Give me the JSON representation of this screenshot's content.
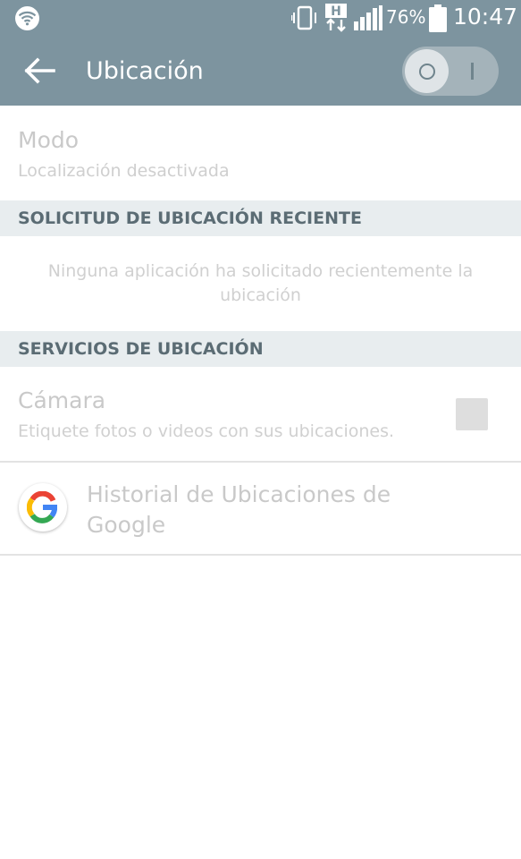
{
  "status_bar": {
    "battery_percent": "76%",
    "time": "10:47",
    "icons": [
      "wifi-icon",
      "vibrate-icon",
      "h-data-icon",
      "signal-icon",
      "battery-icon"
    ]
  },
  "action_bar": {
    "title": "Ubicación",
    "back_icon": "back-arrow-icon",
    "toggle": {
      "state": "off"
    }
  },
  "mode": {
    "title": "Modo",
    "subtitle": "Localización desactivada"
  },
  "recent_requests": {
    "header": "SOLICITUD DE UBICACIÓN RECIENTE",
    "empty_message": "Ninguna aplicación ha solicitado recientemente la ubicación"
  },
  "services": {
    "header": "SERVICIOS DE UBICACIÓN",
    "camera": {
      "title": "Cámara",
      "subtitle": "Etiquete fotos o videos con sus ubicaciones.",
      "checked": false
    },
    "google_history": {
      "title": "Historial de Ubicaciones de Google",
      "icon": "google-g-icon"
    }
  },
  "colors": {
    "bar": "#7d949f",
    "section_header_bg": "#e8edef",
    "section_header_text": "#5b6c74",
    "disabled_text": "#c9c9c9"
  }
}
